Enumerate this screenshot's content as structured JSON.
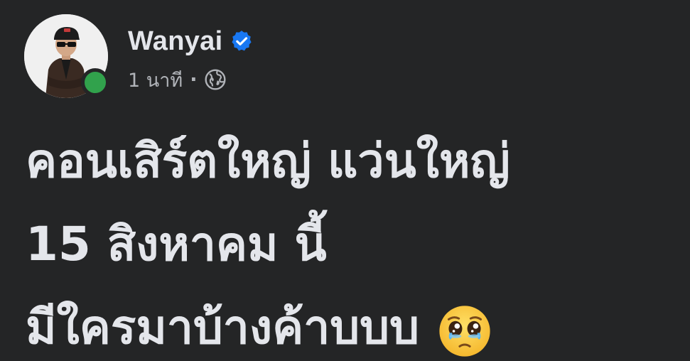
{
  "post": {
    "author": {
      "name": "Wanyai",
      "verified": true,
      "online": true,
      "avatar_icon": "avatar-photo"
    },
    "timestamp": "1 นาที",
    "separator": "·",
    "audience_icon": "globe-icon",
    "text_lines": [
      "คอนเสิร์ตใหญ่ แว่นใหญ่",
      "15 สิงหาคม นี้",
      "มีใครมาบ้างค้าบบบ"
    ],
    "emoji": "pleading-face-with-tears",
    "colors": {
      "background": "#242526",
      "text": "#e4e6eb",
      "secondary_text": "#b0b3b8",
      "verified_blue": "#1877f2",
      "online_green": "#31a24c"
    }
  }
}
